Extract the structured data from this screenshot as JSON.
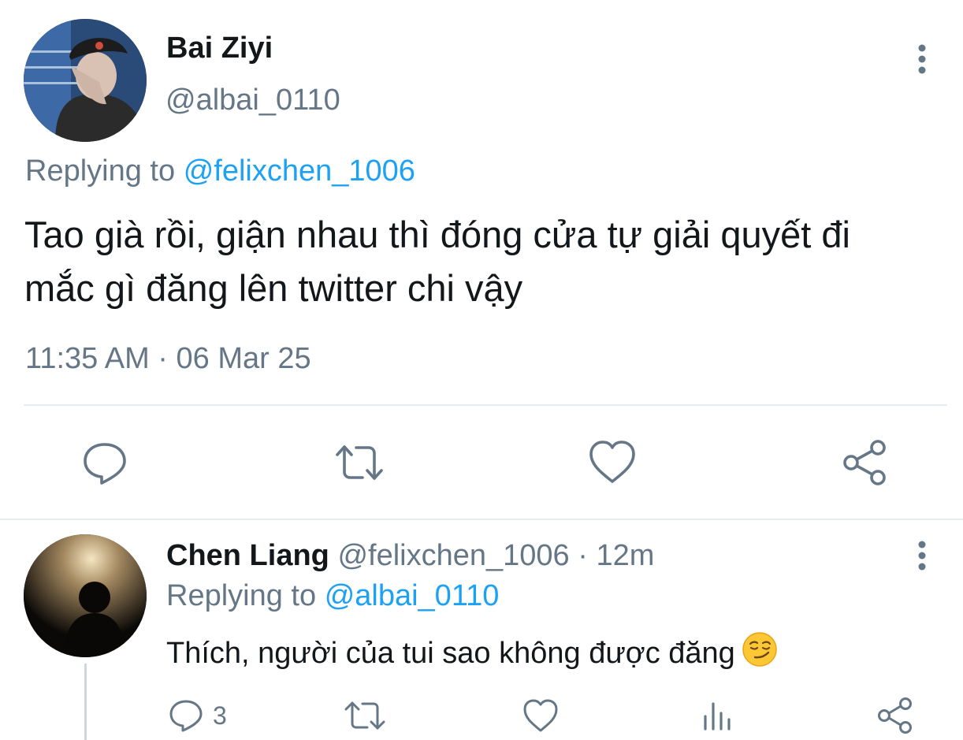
{
  "main_tweet": {
    "author_name": "Bai Ziyi",
    "author_handle": "@albai_0110",
    "replying_label": "Replying to",
    "replying_to": "@felixchen_1006",
    "text_line1": "Tao già rồi, giận nhau thì đóng cửa tự giải quyết đi",
    "text_line2": "mắc gì đăng lên twitter chi vậy",
    "timestamp": "11:35 AM · 06 Mar 25",
    "actions": [
      "reply-icon",
      "retweet-icon",
      "like-icon",
      "share-icon"
    ]
  },
  "reply_tweet": {
    "author_name": "Chen Liang",
    "author_handle": "@felixchen_1006",
    "time_ago": "· 12m",
    "replying_label": "Replying to",
    "replying_to": "@albai_0110",
    "text": "Thích, người của tui sao không được đăng",
    "emoji": "smirking-face-emoji",
    "reply_count": "3",
    "actions": [
      "reply-icon",
      "retweet-icon",
      "like-icon",
      "analytics-icon",
      "share-icon"
    ]
  },
  "colors": {
    "text": "#14171a",
    "secondary": "#657786",
    "link": "#1da1f2",
    "divider": "#e6ecf0"
  }
}
